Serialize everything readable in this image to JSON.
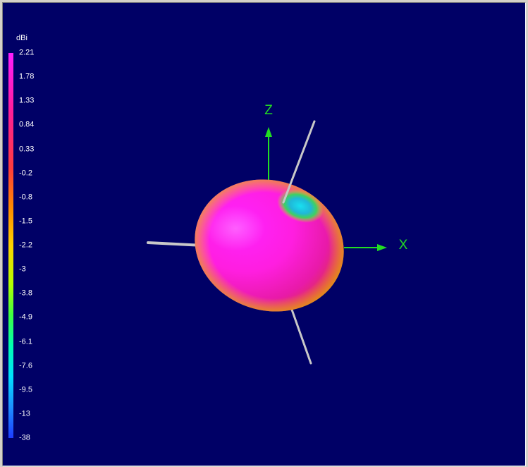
{
  "scale": {
    "unit": "dBi",
    "ticks": [
      "2.21",
      "1.78",
      "1.33",
      "0.84",
      "0.33",
      "-0.2",
      "-0.8",
      "-1.5",
      "-2.2",
      "-3",
      "-3.8",
      "-4.9",
      "-6.1",
      "-7.6",
      "-9.5",
      "-13",
      "-38"
    ]
  },
  "axes": {
    "z_label": "Z",
    "x_label": "X",
    "axis_color": "#22dd22"
  },
  "colors": {
    "background": "#000066",
    "pattern_main": "#ff1ee8",
    "pattern_null": "#20c8e0",
    "element_color": "#c8c8c8"
  }
}
